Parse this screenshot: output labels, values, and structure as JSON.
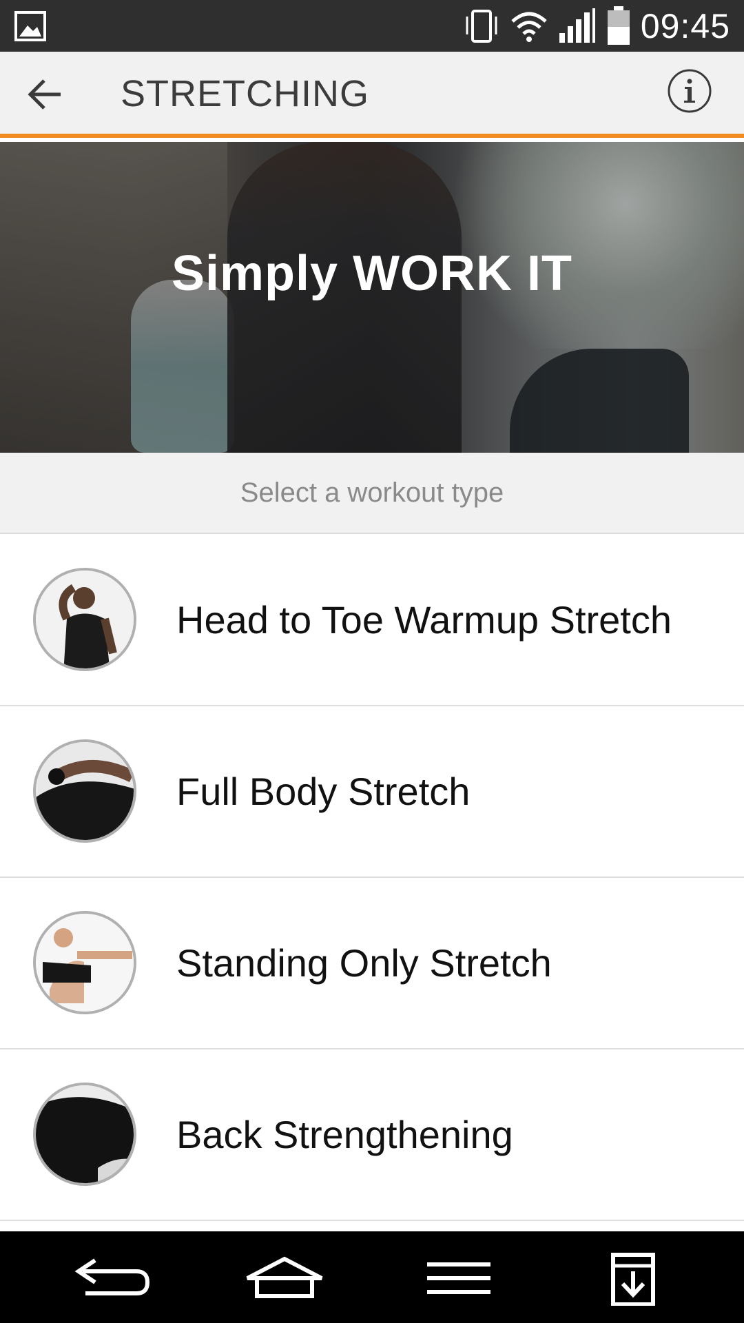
{
  "status_bar": {
    "time": "09:45",
    "icons": [
      "gallery-icon",
      "vibrate-icon",
      "wifi-icon",
      "signal-icon",
      "battery-icon"
    ]
  },
  "app_bar": {
    "title": "STRETCHING",
    "back_icon": "arrow-left-icon",
    "info_icon": "info-icon",
    "accent_color": "#f28a22"
  },
  "hero": {
    "headline": "Simply WORK IT"
  },
  "section": {
    "label": "Select a workout type"
  },
  "workouts": [
    {
      "label": "Head to Toe Warmup Stretch"
    },
    {
      "label": "Full Body Stretch"
    },
    {
      "label": "Standing Only Stretch"
    },
    {
      "label": "Back Strengthening"
    }
  ],
  "nav_bar": {
    "icons": [
      "back-icon",
      "home-icon",
      "menu-icon",
      "download-icon"
    ]
  }
}
